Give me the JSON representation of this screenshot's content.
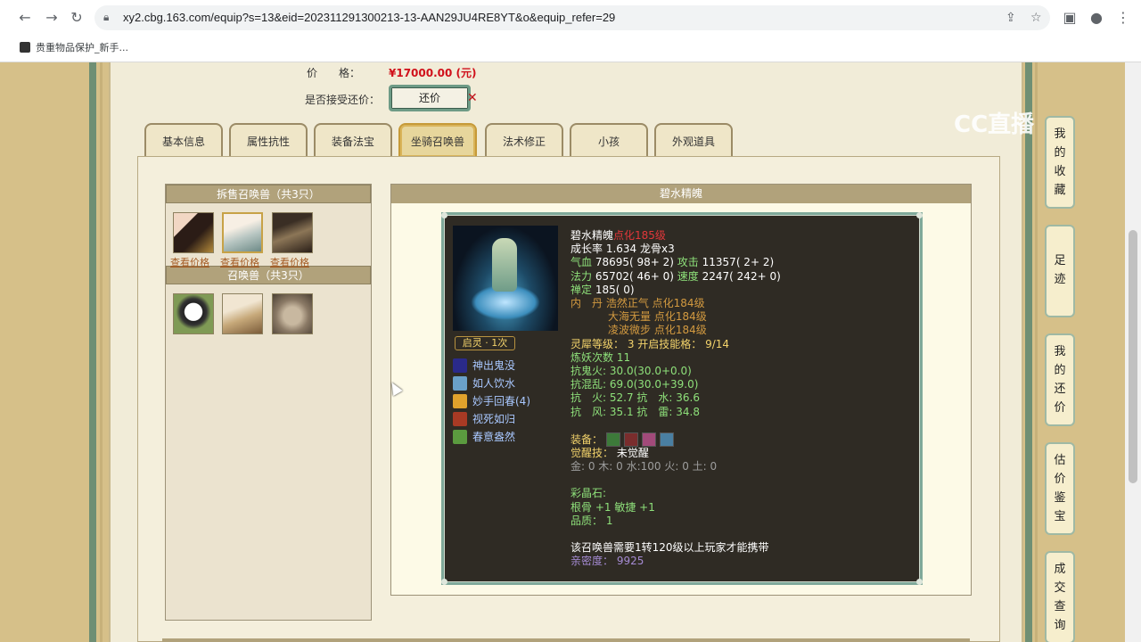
{
  "browser": {
    "url": "xy2.cbg.163.com/equip?s=13&eid=202311291300213-13-AAN29JU4RE8YT&o&equip_refer=29",
    "bookmark": "贵重物品保护_新手..."
  },
  "watermark": "CC直播",
  "price": {
    "label": "价　　格：",
    "value": "¥17000.00 (元)"
  },
  "bargain": {
    "label": "是否接受还价：",
    "button": "还价",
    "mark": "✕"
  },
  "tabs": [
    "基本信息",
    "属性抗性",
    "装备法宝",
    "坐骑召唤兽",
    "法术修正",
    "小孩",
    "外观道具"
  ],
  "left": {
    "sell_header": "拆售召唤兽（共3只）",
    "view_price": "查看价格",
    "summon_header": "召唤兽（共3只）"
  },
  "right": {
    "header": "碧水精魄",
    "qiling": "启灵 · 1次",
    "skills": [
      "神出鬼没",
      "如人饮水",
      "妙手回春(4)",
      "视死如归",
      "春意盎然"
    ],
    "info": {
      "name": "碧水精魄",
      "name_tag": "点化185级",
      "growth": "成长率 1.634 龙骨x3",
      "hp_label": "气血",
      "hp": "78695( 98+ 2)",
      "atk_label": "攻击",
      "atk": "11357( 2+ 2)",
      "mp_label": "法力",
      "mp": "65702( 46+ 0)",
      "spd_label": "速度",
      "spd": "2247( 242+ 0)",
      "ding_label": "禅定",
      "ding": "185( 0)",
      "neidan_label": "内　丹",
      "neidan1": "浩然正气 点化184级",
      "neidan2": "大海无量 点化184级",
      "neidan3": "凌波微步 点化184级",
      "lingxi": "灵犀等级：  3 开启技能格：  9/14",
      "lianyao": "炼妖次数 11",
      "res1": "抗鬼火: 30.0(30.0+0.0)",
      "res2": "抗混乱: 69.0(30.0+39.0)",
      "res3": "抗　火: 52.7 抗　水: 36.6",
      "res4": "抗　风: 35.1 抗　雷: 34.8",
      "equip_label": "装备：",
      "awaken_label": "觉醒技：",
      "awaken_value": "未觉醒",
      "elements": "金: 0 木: 0 水:100 火: 0 土: 0",
      "caijing_label": "彩晶石:",
      "caijing_value": "根骨 +1 敏捷 +1",
      "quality": "品质：  1",
      "requirement": "该召唤兽需要1转120级以上玩家才能携带",
      "intimacy": "亲密度：  9925"
    }
  },
  "side_nav": [
    [
      "我",
      "的",
      "收",
      "藏"
    ],
    [
      "足",
      "迹"
    ],
    [
      "我",
      "的",
      "还",
      "价"
    ],
    [
      "估",
      "价",
      "鉴",
      "宝"
    ],
    [
      "成",
      "交",
      "查",
      "询"
    ]
  ],
  "colors": {
    "price_red": "#d0101a",
    "stat_green": "#8ee07a",
    "panel_dark": "#2f2b24",
    "header_tan": "#b1a27b"
  }
}
